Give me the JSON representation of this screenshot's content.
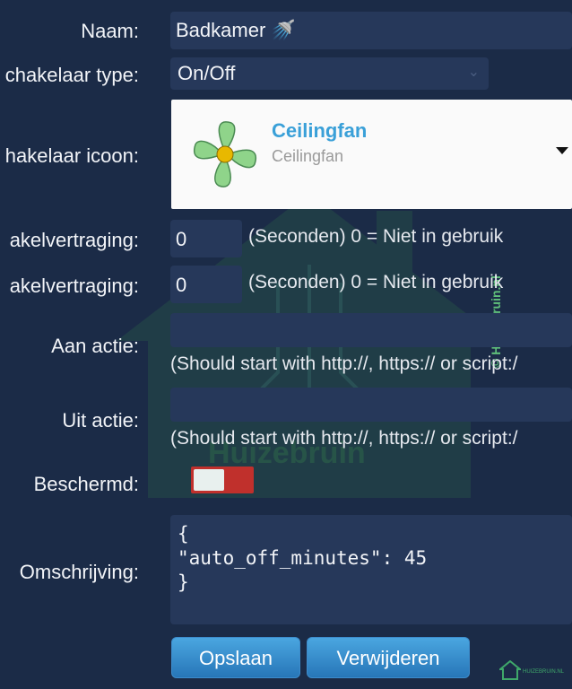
{
  "form": {
    "name": {
      "label": "Naam:",
      "value": "Badkamer 🚿"
    },
    "switch_type": {
      "label": "chakelaar type:",
      "value": "On/Off"
    },
    "switch_icon": {
      "label": "hakelaar icoon:",
      "title": "Ceilingfan",
      "subtitle": "Ceilingfan"
    },
    "delay_on": {
      "label": "akelvertraging:",
      "value": "0",
      "hint": "(Seconden) 0 = Niet in gebruik"
    },
    "delay_off": {
      "label": "akelvertraging:",
      "value": "0",
      "hint": "(Seconden) 0 = Niet in gebruik"
    },
    "on_action": {
      "label": "Aan actie:",
      "value": "",
      "hint": "(Should start with http://, https:// or script:/"
    },
    "off_action": {
      "label": "Uit actie:",
      "value": "",
      "hint": "(Should start with http://, https:// or script:/"
    },
    "protected": {
      "label": "Beschermd:",
      "state": "off"
    },
    "description": {
      "label": "Omschrijving:",
      "value": "{\n\"auto_off_minutes\": 45\n}"
    }
  },
  "buttons": {
    "save": "Opslaan",
    "delete": "Verwijderen"
  },
  "watermark": {
    "text": "Huizebruin",
    "side_text": "© Huizebruin.nl",
    "corner_text": "HUIZEBRUIN.NL"
  },
  "colors": {
    "background": "#1b2b47",
    "field": "#26385a",
    "accent": "#3aa0d8",
    "toggle_red": "#c0302c"
  }
}
